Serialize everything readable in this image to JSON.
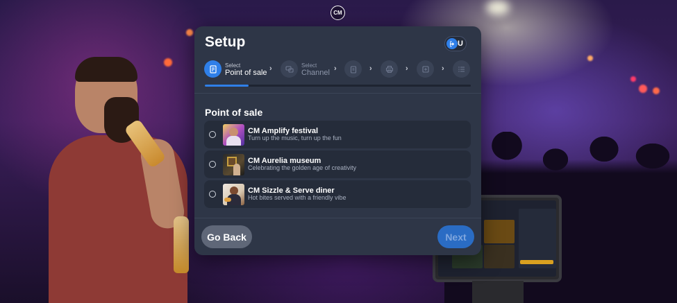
{
  "brand": {
    "logo_text": "CM"
  },
  "dialog": {
    "title": "Setup",
    "user_initials": "DU",
    "steps": [
      {
        "sub": "Select",
        "main": "Point of sale",
        "icon": "pos-icon",
        "active": true
      },
      {
        "sub": "Select",
        "main": "Channel",
        "icon": "channel-icon",
        "active": false
      },
      {
        "sub": "",
        "main": "",
        "icon": "clipboard-icon",
        "active": false
      },
      {
        "sub": "",
        "main": "",
        "icon": "printer-icon",
        "active": false
      },
      {
        "sub": "",
        "main": "",
        "icon": "cash-register-icon",
        "active": false
      },
      {
        "sub": "",
        "main": "",
        "icon": "list-icon",
        "active": false
      }
    ],
    "progress": 0.165,
    "section_title": "Point of sale",
    "options": [
      {
        "title": "CM Amplify festival",
        "subtitle": "Turn up the music, turn up the fun",
        "selected": false
      },
      {
        "title": "CM Aurelia museum",
        "subtitle": "Celebrating the golden age of creativity",
        "selected": false
      },
      {
        "title": "CM Sizzle & Serve diner",
        "subtitle": "Hot bites served with a friendly vibe",
        "selected": false
      }
    ],
    "back_label": "Go Back",
    "next_label": "Next"
  },
  "colors": {
    "accent": "#2f7fe8",
    "dialog_bg": "#2e3647",
    "option_bg": "#252c3a"
  }
}
